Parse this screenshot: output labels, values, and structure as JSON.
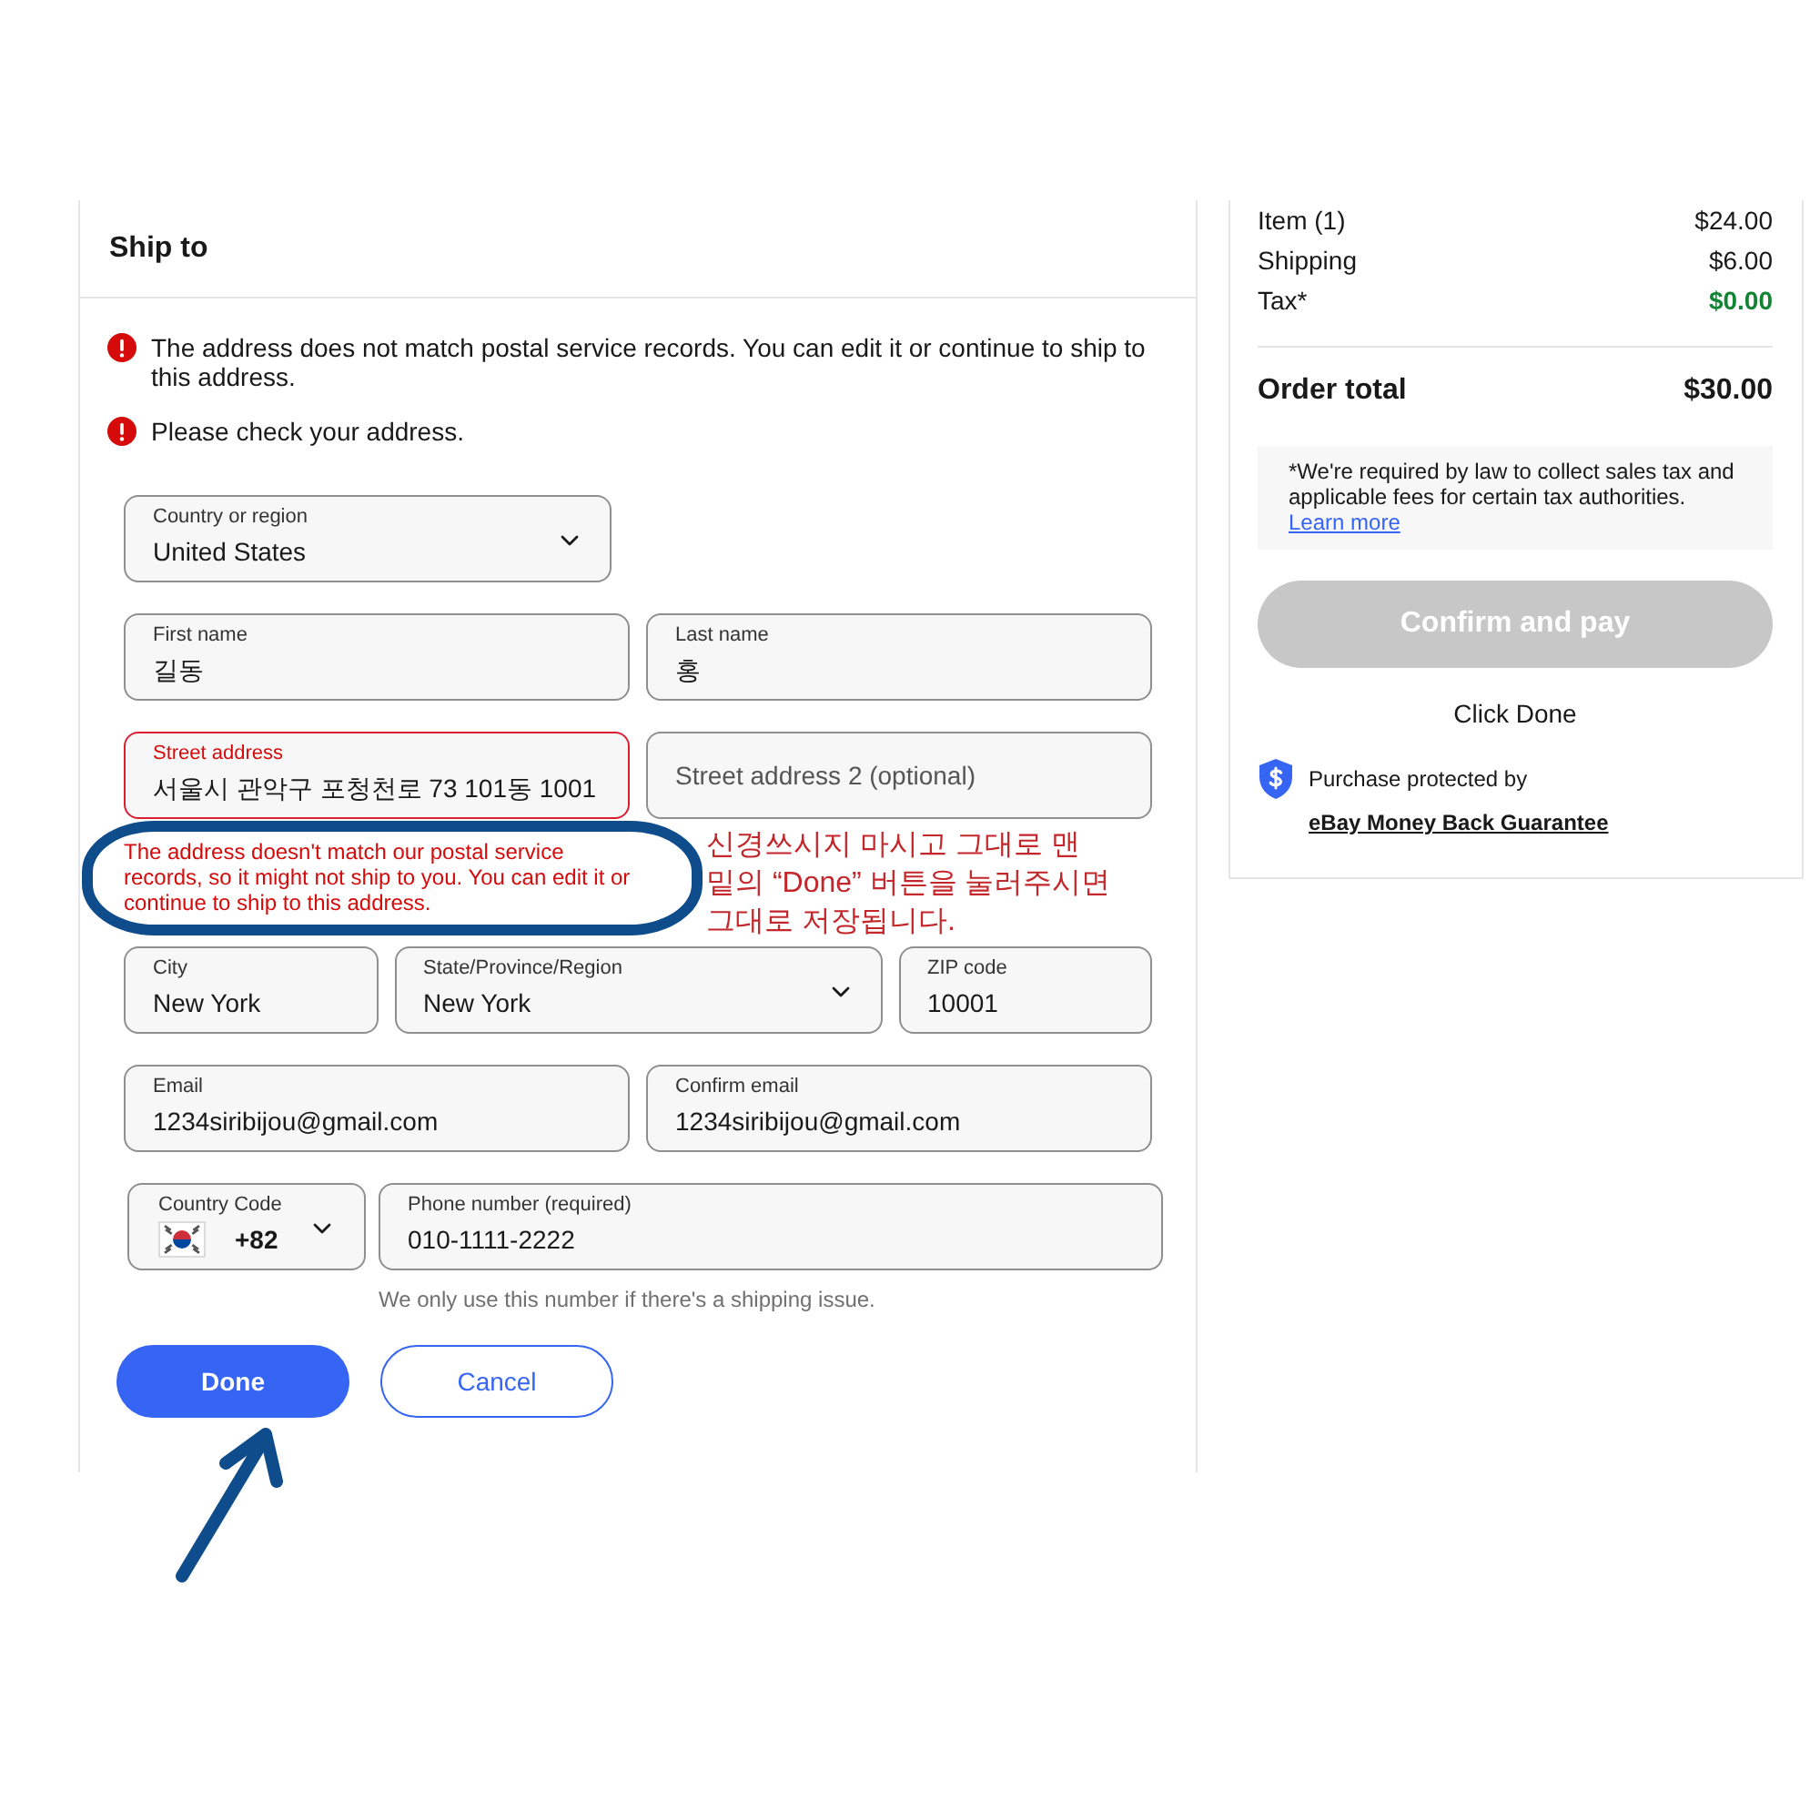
{
  "ship_to": {
    "title": "Ship to",
    "alerts": [
      "The address does not match postal service records. You can edit it or continue to ship to this address.",
      "Please check your address."
    ],
    "rows": [
      [
        {
          "kind": "select",
          "label": "Country or region",
          "value": "United States",
          "error": false
        }
      ],
      [
        {
          "kind": "text",
          "label": "First name",
          "value": "길동",
          "error": false
        },
        {
          "kind": "text",
          "label": "Last name",
          "value": "홍",
          "error": false
        }
      ],
      [
        {
          "kind": "text",
          "label": "Street address",
          "value": "서울시 관악구 포청천로 73 101동 1001",
          "error": true,
          "error_message": "The address doesn't match our postal service records, so it might not ship to you. You can edit it or continue to ship to this address."
        },
        {
          "kind": "text",
          "placeholder": "Street address 2 (optional)",
          "error": false
        }
      ],
      [
        {
          "kind": "text",
          "label": "City",
          "value": "New York",
          "error": false
        },
        {
          "kind": "select",
          "label": "State/Province/Region",
          "value": "New York",
          "error": false
        },
        {
          "kind": "text",
          "label": "ZIP code",
          "value": "10001",
          "error": false
        }
      ],
      [
        {
          "kind": "text",
          "label": "Email",
          "value": "1234siribijou@gmail.com",
          "error": false
        },
        {
          "kind": "text",
          "label": "Confirm email",
          "value": "1234siribijou@gmail.com",
          "error": false
        }
      ],
      [
        {
          "kind": "country_code",
          "label": "Country Code",
          "value": "+82",
          "error": false
        },
        {
          "kind": "text",
          "label": "Phone number (required)",
          "value": "010-1111-2222",
          "error": false,
          "hint": "We only use this number if there's a shipping issue."
        }
      ]
    ],
    "buttons": [
      {
        "kind": "primary",
        "label": "Done"
      },
      {
        "kind": "secondary",
        "label": "Cancel"
      }
    ]
  },
  "order_summary": {
    "lines": [
      {
        "label": "Item (1)",
        "amount": "$24.00",
        "color": "#191919",
        "bold": false
      },
      {
        "label": "Shipping",
        "amount": "$6.00",
        "color": "#191919",
        "bold": false
      },
      {
        "label": "Tax*",
        "amount": "$0.00",
        "color": "#118533",
        "bold": true
      }
    ],
    "total": {
      "label": "Order total",
      "amount": "$30.00"
    },
    "tax_note": {
      "text": "*We're required by law to collect sales tax and applicable fees for certain tax authorities.",
      "link": "Learn more"
    },
    "pay_button": {
      "label": "Confirm and pay",
      "disabled": true
    },
    "status": "Click Done",
    "protection": {
      "text": "Purchase protected by",
      "link": "eBay Money Back Guarantee"
    }
  },
  "annotation": {
    "note_lines": [
      "신경쓰시지 마시고 그대로 맨",
      "밑의 “Done” 버튼을 눌러주시면",
      "그대로 저장됩니다."
    ]
  }
}
